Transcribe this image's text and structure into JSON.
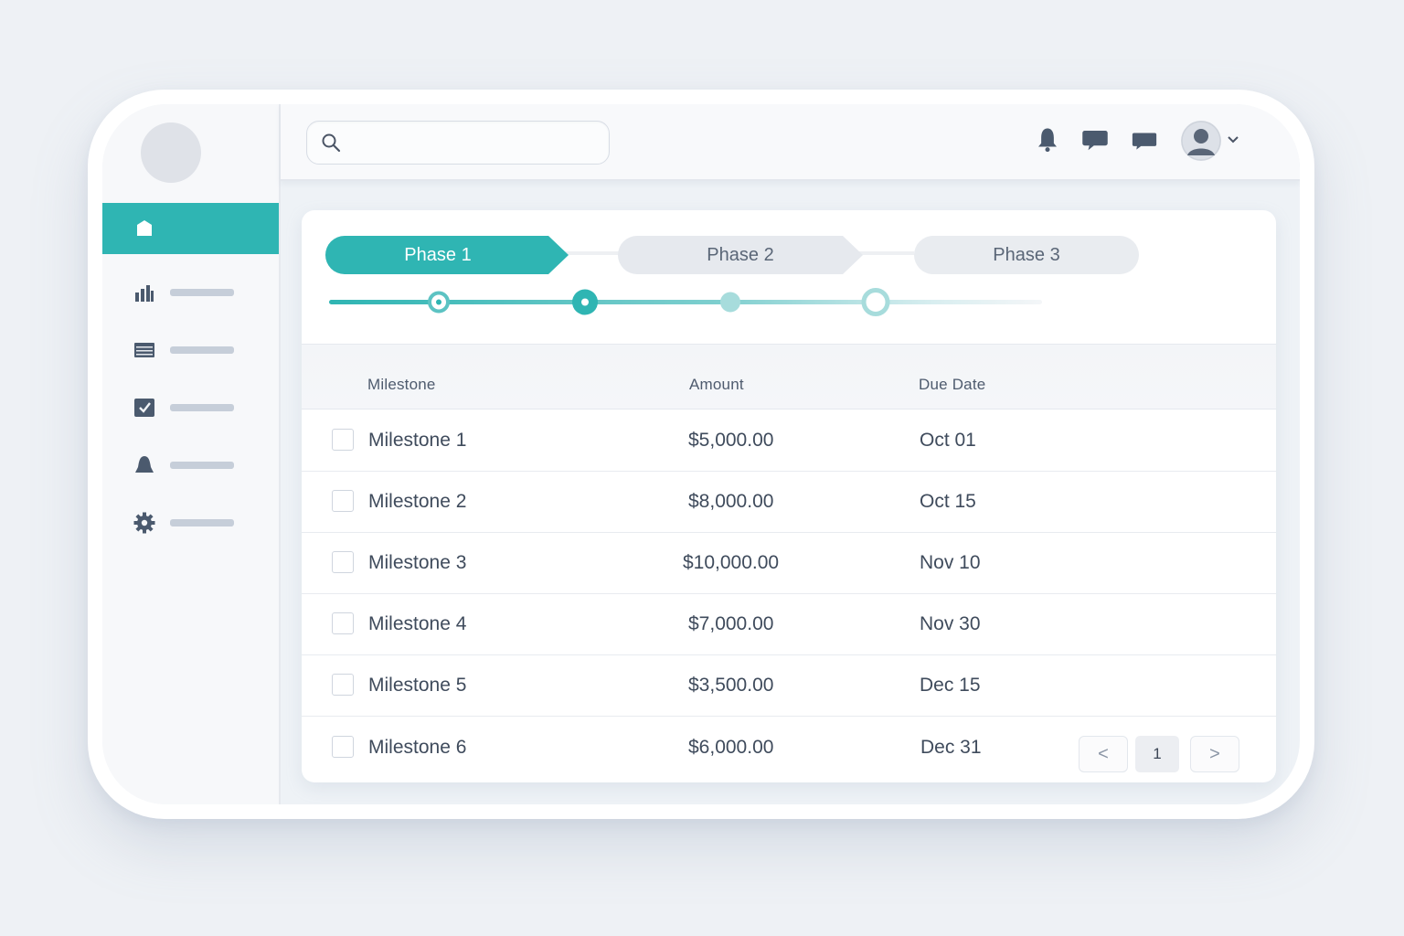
{
  "sidebar": {
    "items": [
      {
        "icon": "home-icon"
      },
      {
        "icon": "bar-chart-icon"
      },
      {
        "icon": "list-icon"
      },
      {
        "icon": "checklist-icon"
      },
      {
        "icon": "bell-icon"
      },
      {
        "icon": "gear-icon"
      }
    ]
  },
  "topbar": {
    "search_placeholder": "",
    "icons": [
      "bell-icon",
      "chat-icon",
      "message-icon",
      "user-avatar",
      "chevron-down-icon"
    ]
  },
  "phases": [
    {
      "label": "Phase 1",
      "active": true
    },
    {
      "label": "Phase 2",
      "active": false
    },
    {
      "label": "Phase 3",
      "active": false
    }
  ],
  "table": {
    "headers": {
      "milestone": "Milestone",
      "amount": "Amount",
      "due_date": "Due Date"
    },
    "rows": [
      {
        "milestone": "Milestone 1",
        "amount": "$5,000.00",
        "due": "Oct 01"
      },
      {
        "milestone": "Milestone 2",
        "amount": "$8,000.00",
        "due": "Oct 15"
      },
      {
        "milestone": "Milestone 3",
        "amount": "$10,000.00",
        "due": "Nov 10"
      },
      {
        "milestone": "Milestone 4",
        "amount": "$7,000.00",
        "due": "Nov 30"
      },
      {
        "milestone": "Milestone 5",
        "amount": "$3,500.00",
        "due": "Dec 15"
      },
      {
        "milestone": "Milestone 6",
        "amount": "$6,000.00",
        "due": "Dec 31"
      }
    ]
  },
  "pagination": {
    "prev": "<",
    "current": "1",
    "next": ">"
  },
  "colors": {
    "accent": "#2fb5b3",
    "muted": "#e6e9ee",
    "text": "#3f4b5c"
  }
}
